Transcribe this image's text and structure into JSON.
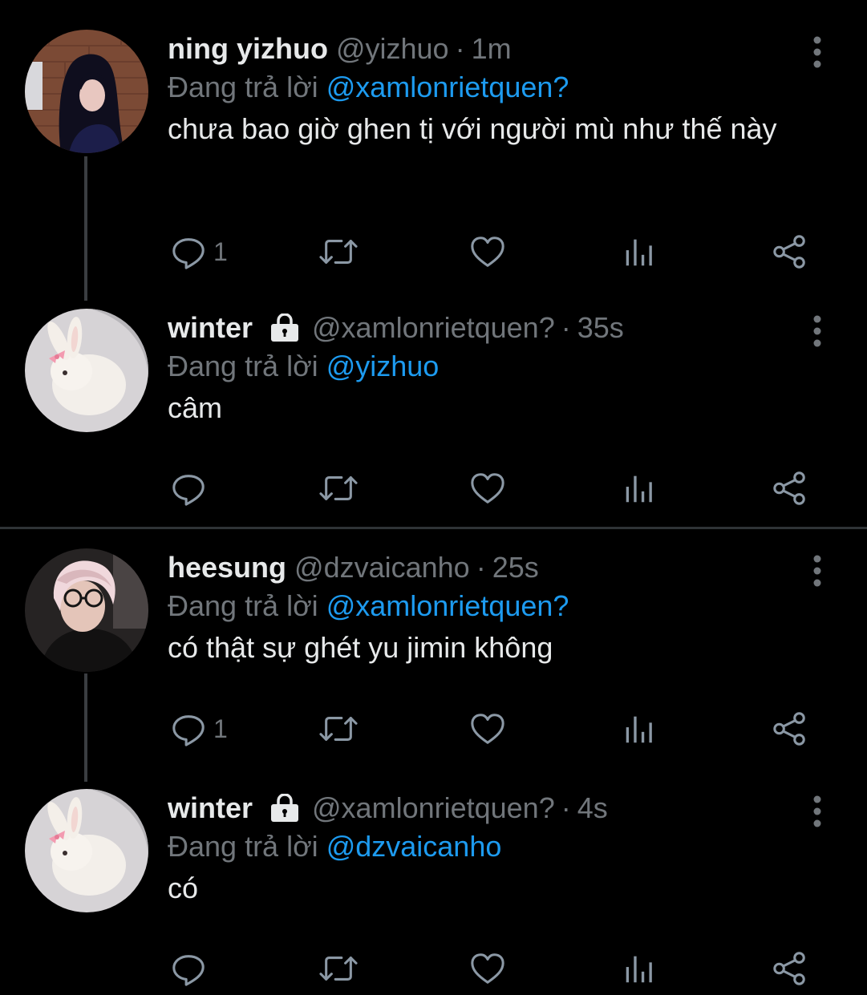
{
  "colors": {
    "background": "#000000",
    "text_primary": "#e7e9ea",
    "text_secondary": "#71767b",
    "mention": "#1d9bf0",
    "thread_line": "#3a3d41",
    "divider": "#2f3336"
  },
  "reply_prefix": "Đang trả lời",
  "tweets": [
    {
      "display_name": "ning yizhuo",
      "handle": "@yizhuo",
      "separator": "·",
      "time": "1m",
      "protected": false,
      "reply_to": "@xamlonrietquen?",
      "text": "chưa bao giờ ghen tị với người mù như thế này",
      "reply_count": "1",
      "avatar": "woman-dark-hair-avatar"
    },
    {
      "display_name": "winter",
      "handle": "@xamlonrietquen?",
      "separator": "·",
      "time": "35s",
      "protected": true,
      "reply_to": "@yizhuo",
      "text": "câm",
      "reply_count": "",
      "avatar": "white-bunny-avatar"
    },
    {
      "display_name": "heesung",
      "handle": "@dzvaicanho",
      "separator": "·",
      "time": "25s",
      "protected": false,
      "reply_to": "@xamlonrietquen?",
      "text": "có thật sự ghét yu jimin không",
      "reply_count": "1",
      "avatar": "man-glasses-avatar"
    },
    {
      "display_name": "winter",
      "handle": "@xamlonrietquen?",
      "separator": "·",
      "time": "4s",
      "protected": true,
      "reply_to": "@dzvaicanho",
      "text": "có",
      "reply_count": "",
      "avatar": "white-bunny-avatar"
    }
  ],
  "icons": [
    "reply-icon",
    "retweet-icon",
    "like-icon",
    "views-icon",
    "share-icon",
    "more-options-icon",
    "lock-icon"
  ]
}
